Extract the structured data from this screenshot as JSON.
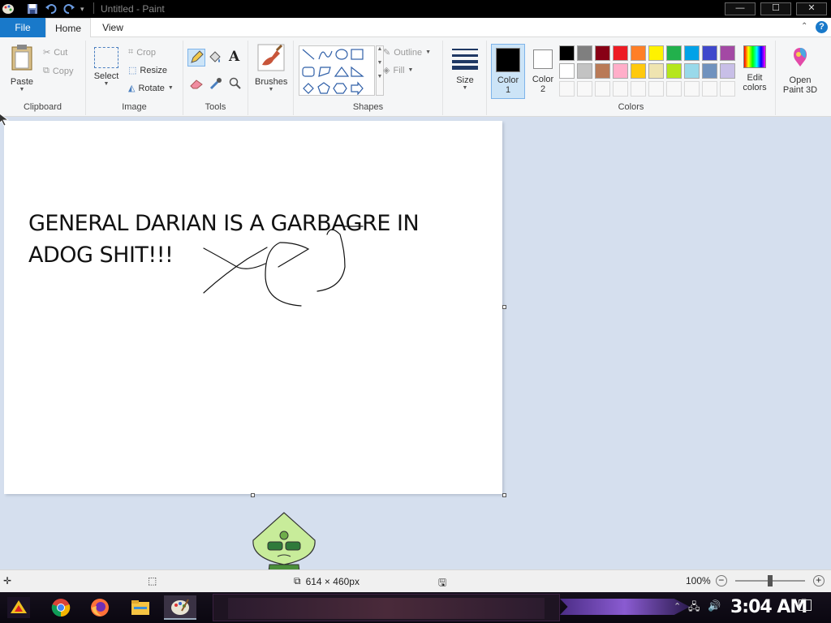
{
  "window": {
    "title": "Untitled - Paint",
    "min_glyph": "—",
    "max_glyph": "☐",
    "close_glyph": "✕"
  },
  "tabs": {
    "file": "File",
    "home": "Home",
    "view": "View",
    "help_glyph": "?"
  },
  "clipboard": {
    "group": "Clipboard",
    "paste": "Paste",
    "cut": "Cut",
    "copy": "Copy"
  },
  "image": {
    "group": "Image",
    "select": "Select",
    "crop": "Crop",
    "resize": "Resize",
    "rotate": "Rotate"
  },
  "tools": {
    "group": "Tools"
  },
  "brushes": {
    "label": "Brushes"
  },
  "shapes": {
    "group": "Shapes",
    "outline": "Outline",
    "fill": "Fill"
  },
  "size": {
    "label": "Size"
  },
  "colors": {
    "group": "Colors",
    "color1_line1": "Color",
    "color1_line2": "1",
    "color2_line1": "Color",
    "color2_line2": "2",
    "edit_line1": "Edit",
    "edit_line2": "colors",
    "paint3d_line1": "Open",
    "paint3d_line2": "Paint 3D",
    "color1": "#000000",
    "color2": "#ffffff",
    "palette_row1": [
      "#000000",
      "#7f7f7f",
      "#880015",
      "#ed1c24",
      "#ff7f27",
      "#fff200",
      "#22b14c",
      "#00a2e8",
      "#3f48cc",
      "#a349a4"
    ],
    "palette_row2": [
      "#ffffff",
      "#c3c3c3",
      "#b97a57",
      "#ffaec9",
      "#ffc90e",
      "#efe4b0",
      "#b5e61d",
      "#99d9ea",
      "#7092be",
      "#c8bfe7"
    ]
  },
  "canvas": {
    "line1": "GENERAL DARIAN IS A GARBAGRE IN",
    "line2": "ADOG SHIT!!!"
  },
  "status": {
    "dimensions": "614 × 460px",
    "zoom": "100%"
  },
  "taskbar": {
    "clock": "3:04 AM"
  }
}
